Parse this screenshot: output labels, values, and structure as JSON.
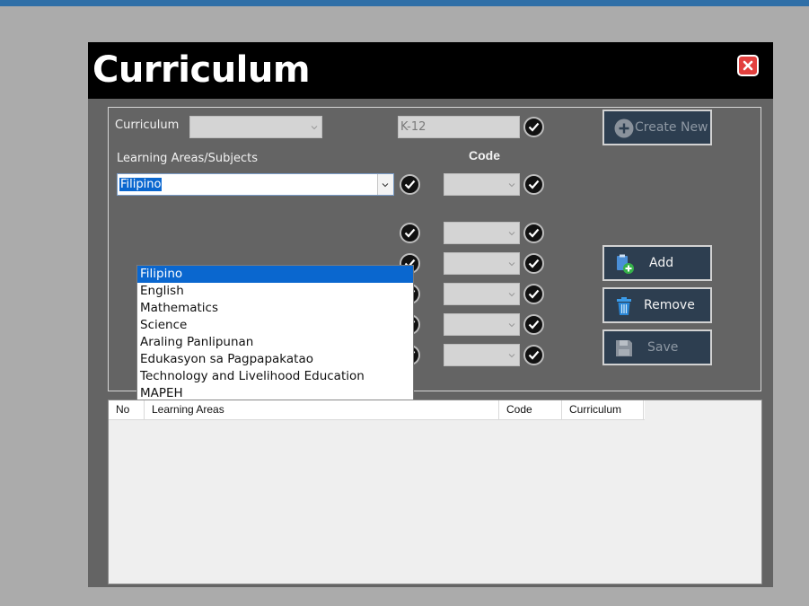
{
  "window": {
    "title": "Curriculum"
  },
  "form": {
    "curriculum_label": "Curriculum",
    "curriculum_value": "",
    "curriculum_text_value": "K-12",
    "learning_areas_label": "Learning Areas/Subjects",
    "code_label": "Code",
    "selected_subject": "Filipino"
  },
  "dropdown": {
    "items": [
      "Filipino",
      "English",
      "Mathematics",
      "Science",
      "Araling Panlipunan",
      "Edukasyon sa Pagpapakatao",
      "Technology and Livelihood Education",
      "MAPEH"
    ],
    "selected_index": 0
  },
  "buttons": {
    "create_new": "Create New",
    "add": "Add",
    "remove": "Remove",
    "save": "Save"
  },
  "table": {
    "columns": [
      "No",
      "Learning Areas",
      "Code",
      "Curriculum"
    ],
    "rows": []
  },
  "colors": {
    "accent": "#0a67cf",
    "button_bg": "#2d3e50",
    "close_red": "#e2403e",
    "window_bg": "#646464"
  }
}
